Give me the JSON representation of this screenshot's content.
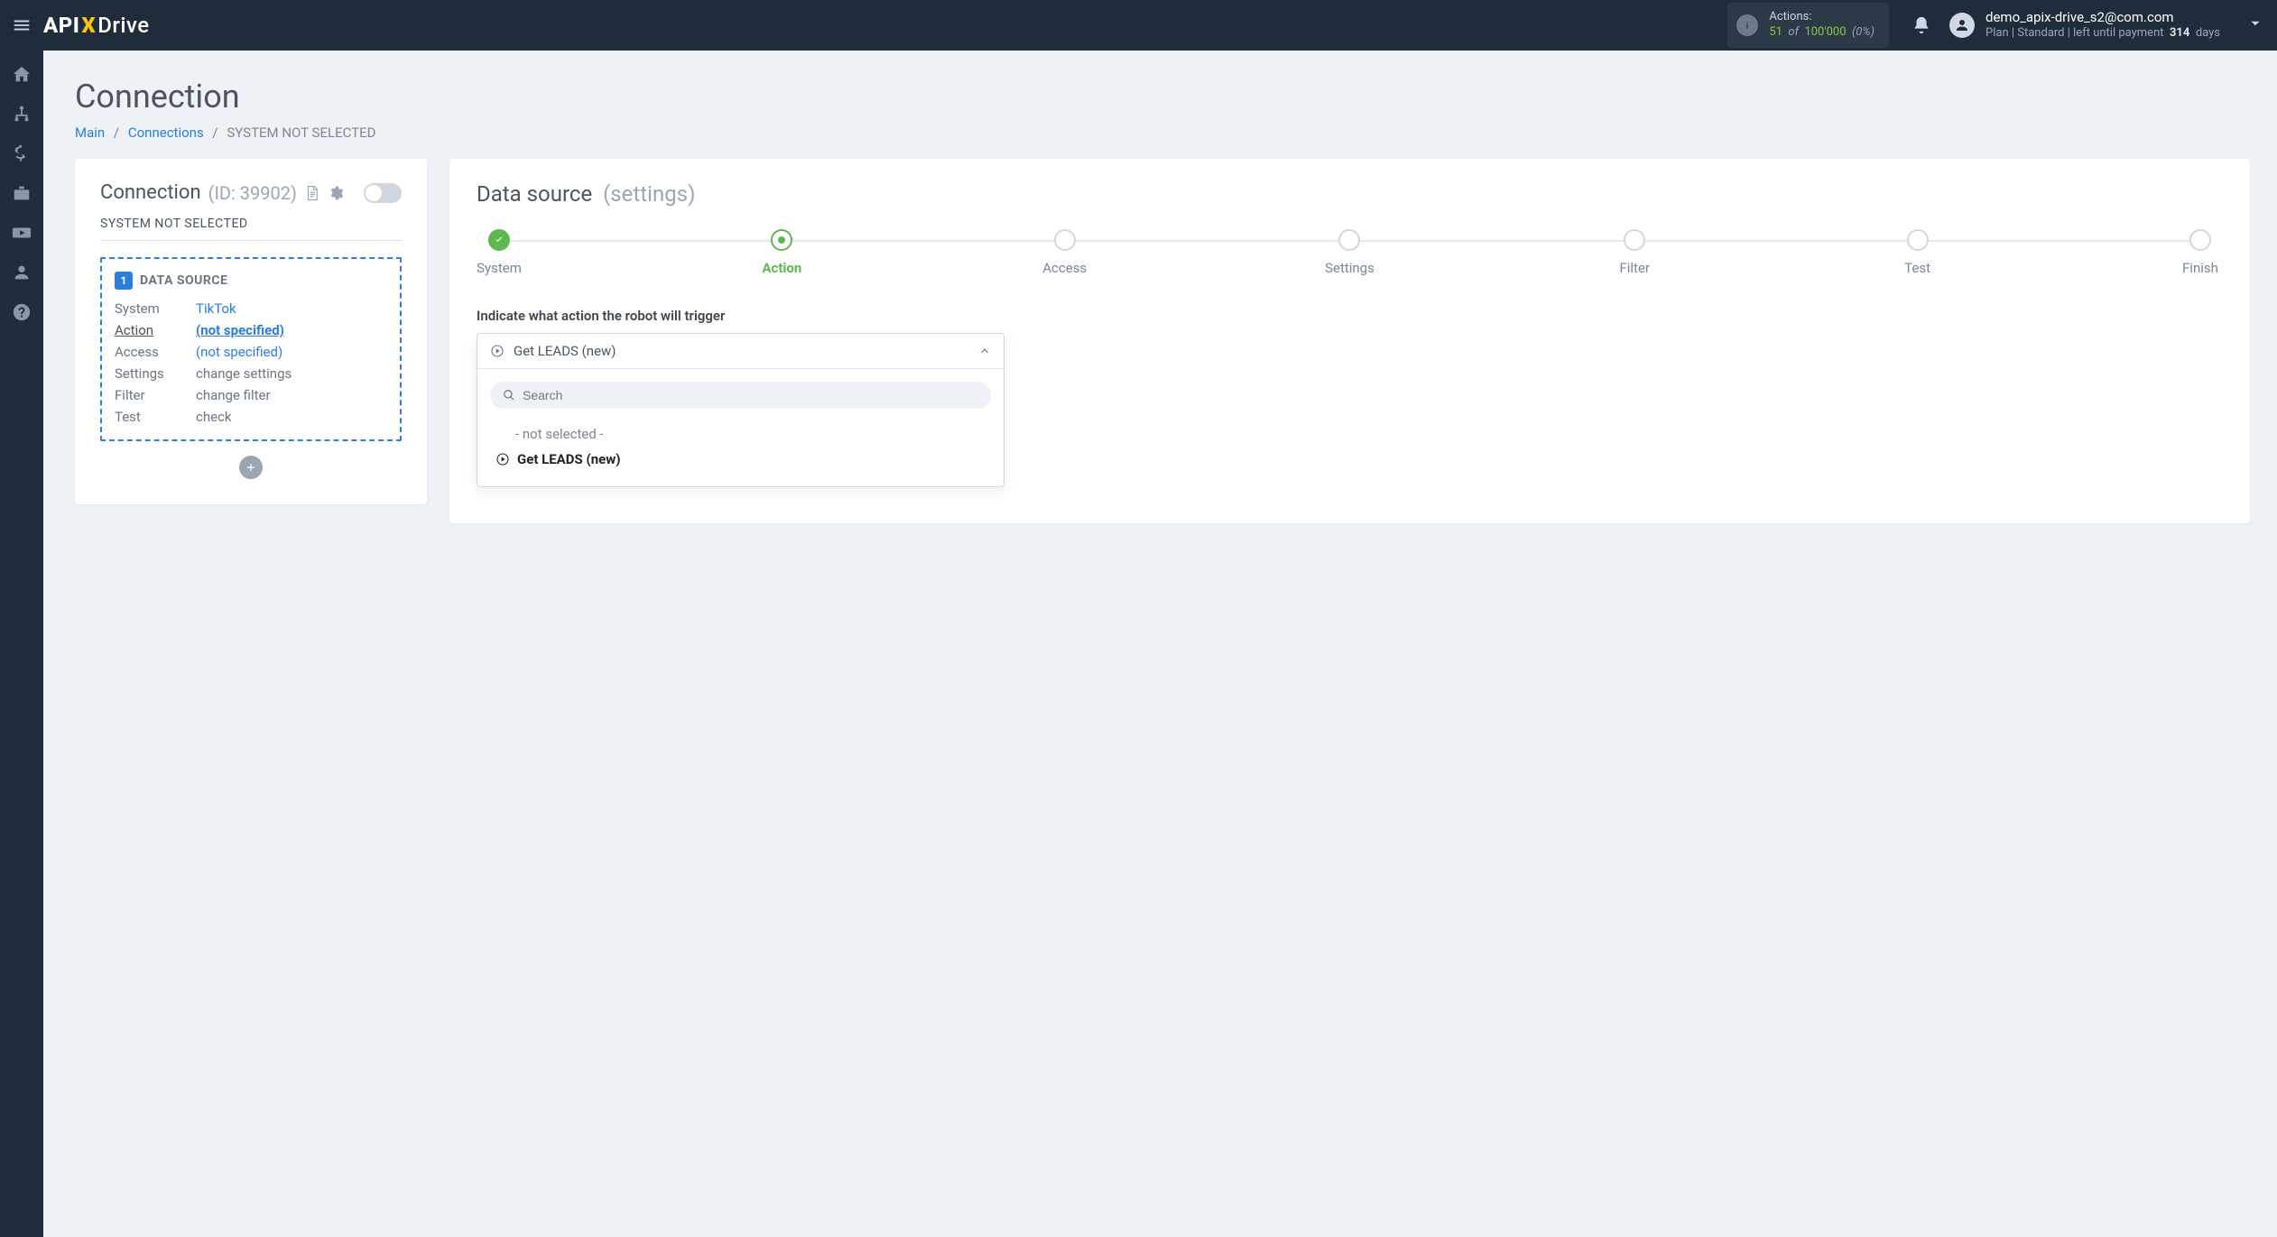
{
  "header": {
    "logo_parts": {
      "api": "API",
      "x": "X",
      "drive": "Drive"
    },
    "actions_label": "Actions:",
    "actions_used": "51",
    "actions_of": "of",
    "actions_limit": "100'000",
    "actions_pct": "(0%)",
    "user_email": "demo_apix-drive_s2@com.com",
    "plan_prefix": "Plan  |",
    "plan_name": "Standard",
    "plan_middle": "|  left until payment",
    "plan_days_num": "314",
    "plan_days_unit": "days"
  },
  "page": {
    "title": "Connection",
    "breadcrumbs": {
      "main": "Main",
      "connections": "Connections",
      "current": "SYSTEM NOT SELECTED"
    }
  },
  "left_card": {
    "title": "Connection",
    "id_text": "(ID: 39902)",
    "subtitle": "SYSTEM NOT SELECTED",
    "ds_badge": "1",
    "ds_title": "DATA SOURCE",
    "rows": {
      "system_k": "System",
      "system_v": "TikTok",
      "action_k": "Action",
      "action_v": "(not specified)",
      "access_k": "Access",
      "access_v": "(not specified)",
      "settings_k": "Settings",
      "settings_v": "change settings",
      "filter_k": "Filter",
      "filter_v": "change filter",
      "test_k": "Test",
      "test_v": "check"
    }
  },
  "right_card": {
    "title_main": "Data source",
    "title_grey": "(settings)",
    "steps": [
      "System",
      "Action",
      "Access",
      "Settings",
      "Filter",
      "Test",
      "Finish"
    ],
    "instruction": "Indicate what action the robot will trigger",
    "selected_action": "Get LEADS (new)",
    "search_placeholder": "Search",
    "options": {
      "none": "- not selected -",
      "opt1": "Get LEADS (new)"
    }
  }
}
